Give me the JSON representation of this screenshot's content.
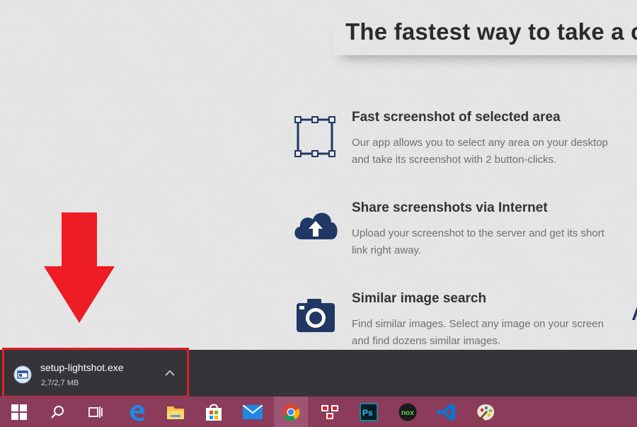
{
  "page": {
    "headline": "The fastest way to take a c",
    "features": [
      {
        "icon": "selection-area-icon",
        "title": "Fast screenshot of selected area",
        "description": "Our app allows you to select any area on your desktop and take its screenshot with 2 button-clicks."
      },
      {
        "icon": "cloud-upload-icon",
        "title": "Share screenshots via Internet",
        "description": "Upload your screenshot to the server and get its short link right away."
      },
      {
        "icon": "camera-icon",
        "title": "Similar image search",
        "description": "Find similar images. Select any image on your screen and find dozens similar images."
      }
    ]
  },
  "annotation": {
    "arrow_color": "#ee1c25",
    "highlight_color": "#e0202a"
  },
  "downloads_bar": {
    "item": {
      "file_name": "setup-lightshot.exe",
      "size": "2,7/2,7 MB"
    }
  },
  "taskbar": {
    "color": "#8a3c5a",
    "items": [
      {
        "icon": "windows-start-icon"
      },
      {
        "icon": "search-icon"
      },
      {
        "icon": "task-view-icon"
      },
      {
        "icon": "edge-icon"
      },
      {
        "icon": "file-explorer-icon"
      },
      {
        "icon": "store-icon"
      },
      {
        "icon": "mail-icon"
      },
      {
        "icon": "chrome-icon",
        "active": true
      },
      {
        "icon": "snipping-tool-icon"
      },
      {
        "icon": "photoshop-icon",
        "label": "Ps"
      },
      {
        "icon": "nox-icon",
        "label": "nox"
      },
      {
        "icon": "vscode-icon"
      },
      {
        "icon": "paint-icon"
      }
    ]
  }
}
